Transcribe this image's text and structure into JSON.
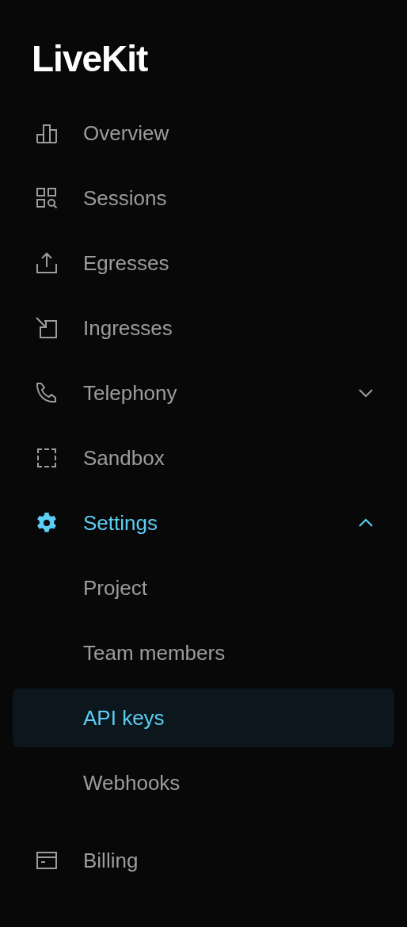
{
  "logo": "LiveKit",
  "nav": [
    {
      "label": "Overview",
      "selected": false
    },
    {
      "label": "Sessions",
      "selected": false
    },
    {
      "label": "Egresses",
      "selected": false
    },
    {
      "label": "Ingresses",
      "selected": false
    },
    {
      "label": "Telephony",
      "selected": false,
      "expanded": false
    },
    {
      "label": "Sandbox",
      "selected": false
    },
    {
      "label": "Settings",
      "selected": true,
      "expanded": true,
      "children": [
        {
          "label": "Project",
          "selected": false
        },
        {
          "label": "Team members",
          "selected": false
        },
        {
          "label": "API keys",
          "selected": true
        },
        {
          "label": "Webhooks",
          "selected": false
        }
      ]
    },
    {
      "label": "Billing",
      "selected": false
    }
  ]
}
